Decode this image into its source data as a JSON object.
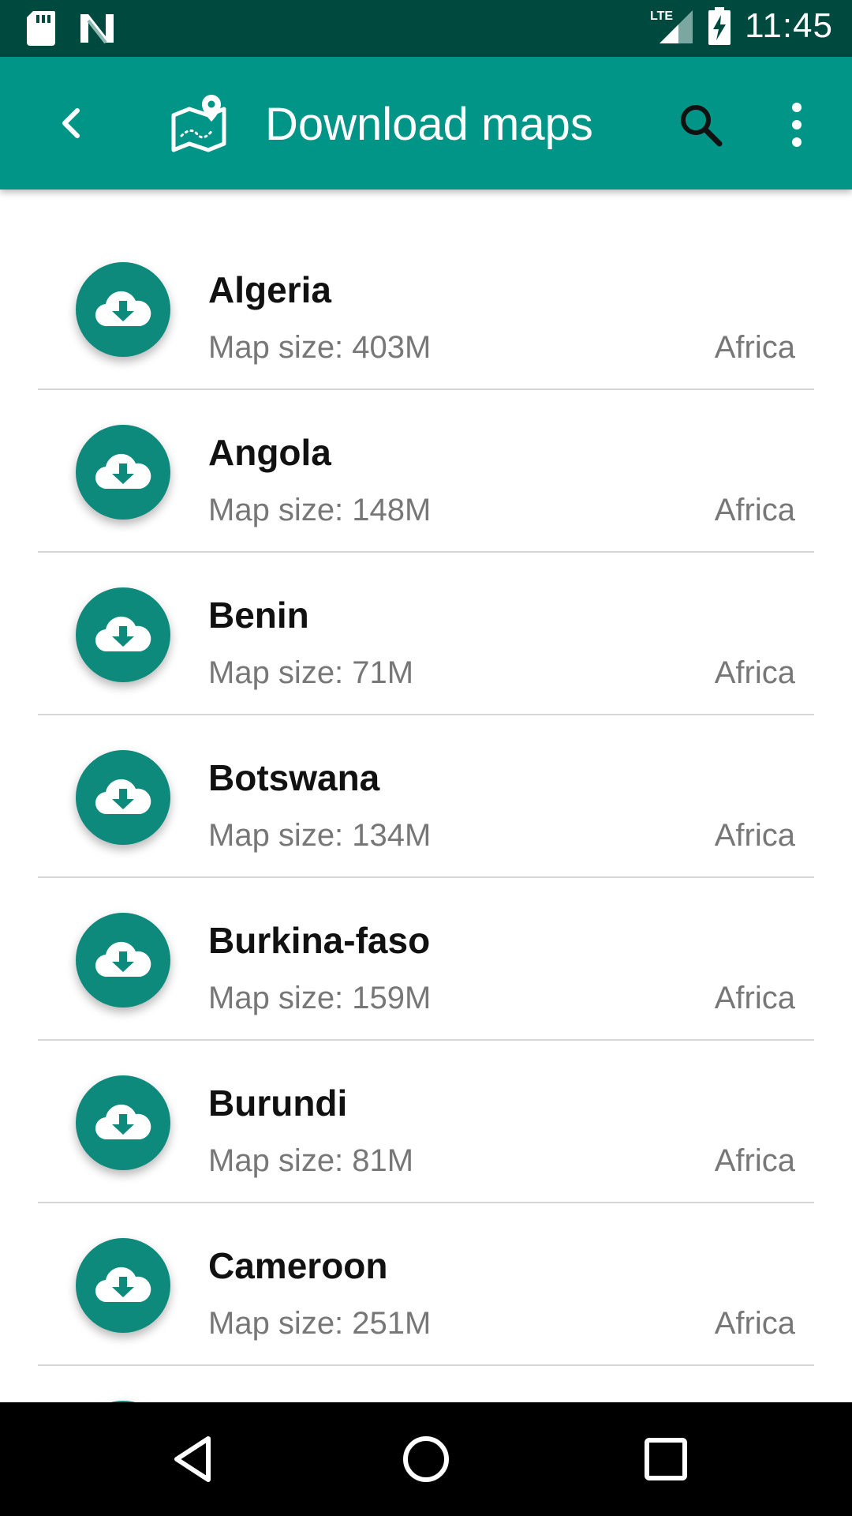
{
  "status_bar": {
    "time": "11:45",
    "network": "LTE",
    "icons": [
      "sd-card-icon",
      "n-logo-icon",
      "lte-signal-icon",
      "battery-charging-icon"
    ]
  },
  "app_bar": {
    "title": "Download maps",
    "icons": [
      "back-arrow-icon",
      "map-logo-icon",
      "search-icon",
      "more-vert-icon"
    ]
  },
  "items": [
    {
      "name": "Algeria",
      "size": "Map size: 403M",
      "region": "Africa"
    },
    {
      "name": "Angola",
      "size": "Map size: 148M",
      "region": "Africa"
    },
    {
      "name": "Benin",
      "size": "Map size: 71M",
      "region": "Africa"
    },
    {
      "name": "Botswana",
      "size": "Map size: 134M",
      "region": "Africa"
    },
    {
      "name": "Burkina-faso",
      "size": "Map size: 159M",
      "region": "Africa"
    },
    {
      "name": "Burundi",
      "size": "Map size: 81M",
      "region": "Africa"
    },
    {
      "name": "Cameroon",
      "size": "Map size: 251M",
      "region": "Africa"
    }
  ],
  "nav_bar": {
    "icons": [
      "nav-back-icon",
      "nav-home-icon",
      "nav-recents-icon"
    ]
  },
  "colors": {
    "status_bar": "#00493f",
    "app_bar": "#009587",
    "download_button": "#0e8a7c",
    "secondary_text": "#777777"
  }
}
